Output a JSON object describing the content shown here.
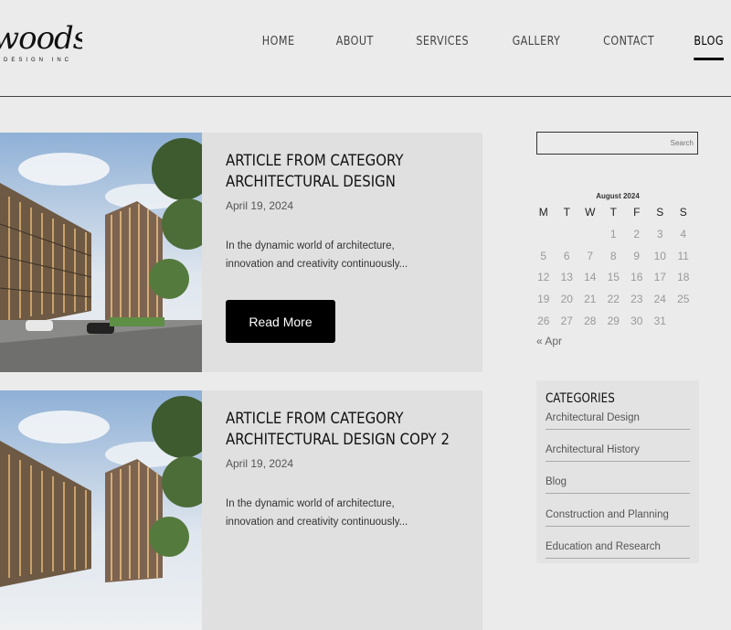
{
  "brand": {
    "name": "woods",
    "tagline": "DESIGN INC"
  },
  "nav": {
    "items": [
      {
        "label": "HOME"
      },
      {
        "label": "ABOUT"
      },
      {
        "label": "SERVICES"
      },
      {
        "label": "GALLERY"
      },
      {
        "label": "CONTACT"
      },
      {
        "label": "BLOG",
        "active": true
      }
    ]
  },
  "posts": [
    {
      "title_line1": "ARTICLE FROM CATEGORY",
      "title_line2": "ARCHITECTURAL DESIGN",
      "date": "April 19, 2024",
      "excerpt": "In the dynamic world of architecture, innovation and creativity continuously...",
      "button": "Read More"
    },
    {
      "title_line1": "ARTICLE FROM CATEGORY",
      "title_line2": "ARCHITECTURAL DESIGN COPY 2",
      "date": "April 19, 2024",
      "excerpt": "In the dynamic world of architecture, innovation and creativity continuously..."
    }
  ],
  "search": {
    "placeholder": "Search"
  },
  "calendar": {
    "caption": "August 2024",
    "weekdays": [
      "M",
      "T",
      "W",
      "T",
      "F",
      "S",
      "S"
    ],
    "weeks": [
      [
        "",
        "",
        "",
        "1",
        "2",
        "3",
        "4"
      ],
      [
        "5",
        "6",
        "7",
        "8",
        "9",
        "10",
        "11"
      ],
      [
        "12",
        "13",
        "14",
        "15",
        "16",
        "17",
        "18"
      ],
      [
        "19",
        "20",
        "21",
        "22",
        "23",
        "24",
        "25"
      ],
      [
        "26",
        "27",
        "28",
        "29",
        "30",
        "31",
        ""
      ]
    ],
    "prev_link": "« Apr"
  },
  "categories": {
    "title": "CATEGORIES",
    "items": [
      "Architectural Design",
      "Architectural History",
      "Blog",
      "Construction and Planning",
      "Education and Research"
    ]
  }
}
